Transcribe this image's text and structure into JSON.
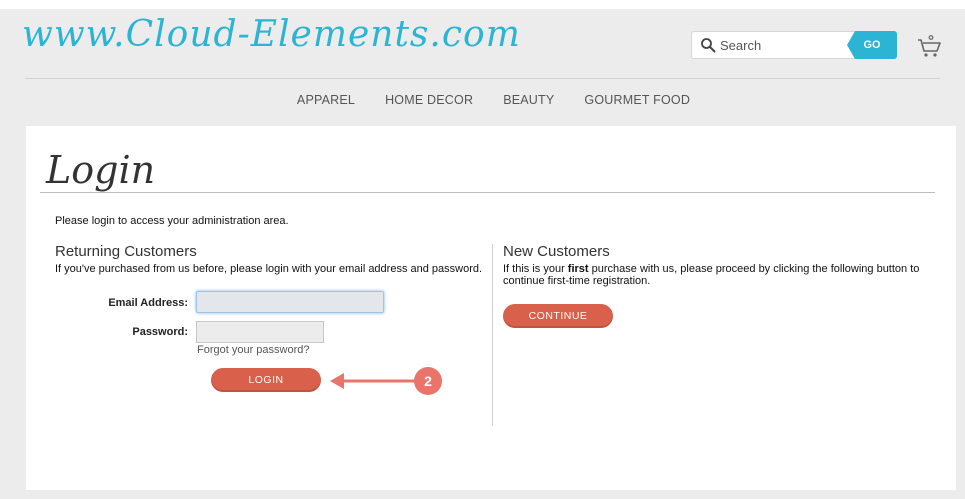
{
  "header": {
    "logo_text": "www.Cloud-Elements.com",
    "search": {
      "placeholder": "Search",
      "button_label": "GO"
    },
    "cart_icon": "cart-icon"
  },
  "nav": {
    "items": [
      "APPAREL",
      "HOME DECOR",
      "BEAUTY",
      "GOURMET FOOD"
    ]
  },
  "page": {
    "title": "Login",
    "intro": "Please login to access your administration area."
  },
  "returning": {
    "heading": "Returning Customers",
    "description": "If you've purchased from us before, please login with your email address and password.",
    "email_label": "Email Address:",
    "password_label": "Password:",
    "forgot_link": "Forgot your password?",
    "login_button": "LOGIN"
  },
  "new_customers": {
    "heading": "New Customers",
    "description_before": "If this is your ",
    "description_bold": "first",
    "description_after": " purchase with us, please proceed by clicking the following button to continue first-time registration.",
    "continue_button": "CONTINUE"
  },
  "annotation": {
    "step_number": "2"
  },
  "colors": {
    "accent": "#2bb4d4",
    "button": "#d9604a",
    "annotation": "#e8746a"
  }
}
